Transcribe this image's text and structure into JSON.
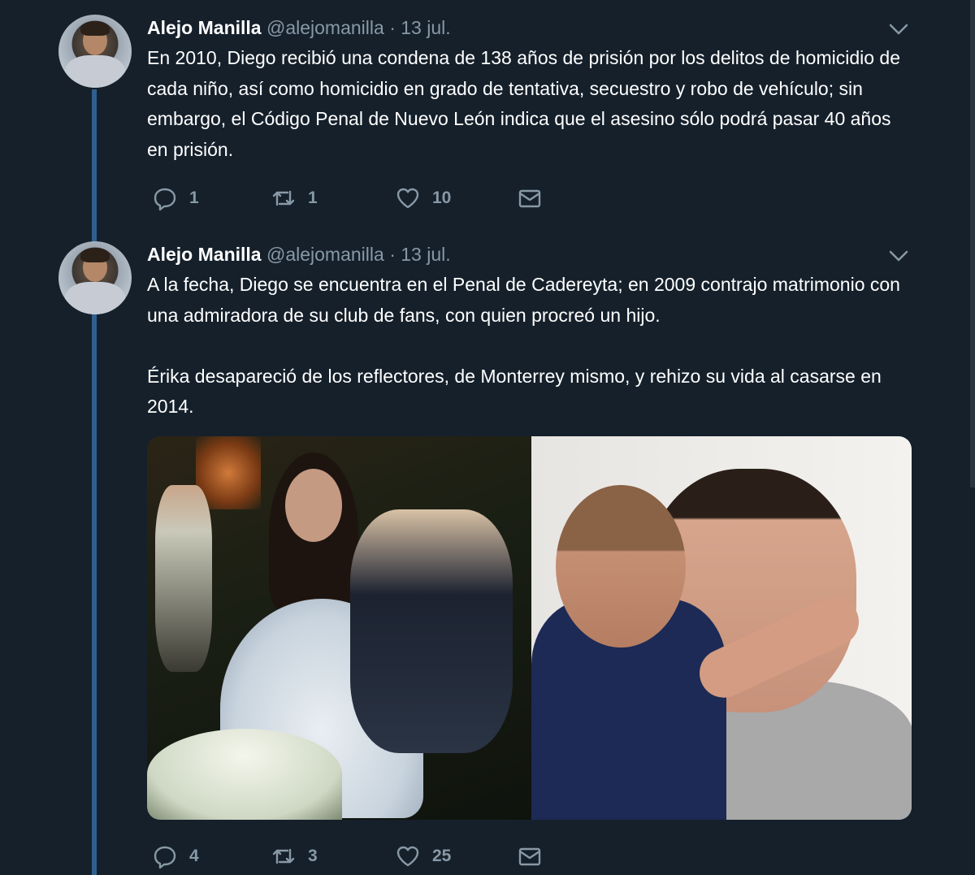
{
  "tweets": [
    {
      "name": "Alejo Manilla",
      "handle": "@alejomanilla",
      "separator": "·",
      "date": "13 jul.",
      "text": "En 2010, Diego recibió una condena de 138 años de prisión por los delitos de homicidio de cada niño, así como homicidio en grado de tentativa, secuestro y robo de vehículo; sin embargo, el Código Penal de Nuevo León indica que el asesino sólo podrá pasar 40 años en prisión.",
      "replies": "1",
      "retweets": "1",
      "likes": "10"
    },
    {
      "name": "Alejo Manilla",
      "handle": "@alejomanilla",
      "separator": "·",
      "date": "13 jul.",
      "text": "A la fecha, Diego se encuentra en el Penal de Cadereyta; en 2009 contrajo matrimonio con una admiradora de su club de fans, con quien procreó un hijo.\n\nÉrika desapareció de los reflectores, de Monterrey mismo, y rehizo su vida al casarse en 2014.",
      "replies": "4",
      "retweets": "3",
      "likes": "25"
    }
  ],
  "colors": {
    "background": "#15202b",
    "muted": "#8899a6",
    "thread": "#2f5f8f"
  },
  "icons": [
    "chevron-down-icon",
    "reply-icon",
    "retweet-icon",
    "like-icon",
    "message-icon"
  ]
}
